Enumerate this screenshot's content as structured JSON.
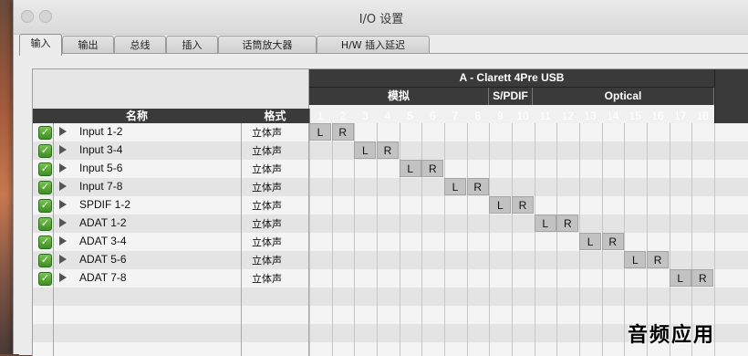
{
  "window": {
    "title": "I/O 设置"
  },
  "tabs": [
    {
      "label": "输入",
      "active": true
    },
    {
      "label": "输出"
    },
    {
      "label": "总线"
    },
    {
      "label": "插入"
    },
    {
      "label": "话筒放大器"
    },
    {
      "label": "H/W 插入延迟"
    }
  ],
  "table": {
    "device": "A - Clarett 4Pre USB",
    "groups": [
      "模拟",
      "S/PDIF",
      "Optical"
    ],
    "col_name": "名称",
    "col_format": "格式",
    "channels": [
      "1",
      "2",
      "3",
      "4",
      "5",
      "6",
      "7",
      "8",
      "9",
      "10",
      "11",
      "12",
      "13",
      "14",
      "15",
      "16",
      "17",
      "18"
    ],
    "left_label": "L",
    "right_label": "R",
    "rows": [
      {
        "name": "Input 1-2",
        "format": "立体声",
        "checked": true
      },
      {
        "name": "Input 3-4",
        "format": "立体声",
        "checked": true
      },
      {
        "name": "Input 5-6",
        "format": "立体声",
        "checked": true
      },
      {
        "name": "Input 7-8",
        "format": "立体声",
        "checked": true
      },
      {
        "name": "SPDIF 1-2",
        "format": "立体声",
        "checked": true
      },
      {
        "name": "ADAT 1-2",
        "format": "立体声",
        "checked": true
      },
      {
        "name": "ADAT 3-4",
        "format": "立体声",
        "checked": true
      },
      {
        "name": "ADAT 5-6",
        "format": "立体声",
        "checked": true
      },
      {
        "name": "ADAT 7-8",
        "format": "立体声",
        "checked": true
      }
    ]
  },
  "watermark": "音频应用"
}
